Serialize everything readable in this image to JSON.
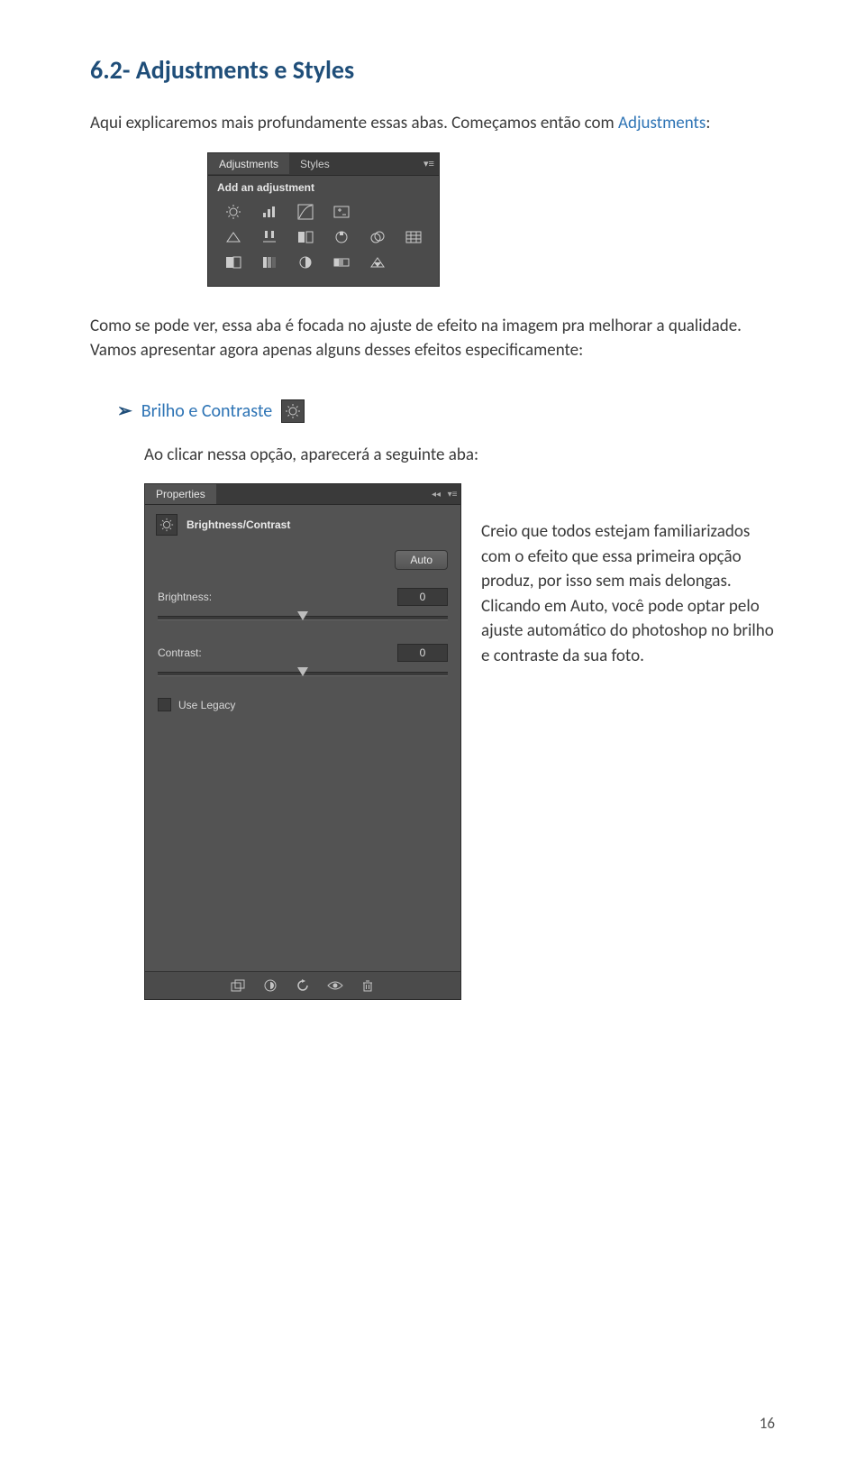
{
  "heading": "6.2- Adjustments e Styles",
  "intro_1": "Aqui explicaremos mais profundamente essas abas. Começamos então com ",
  "intro_link": "Adjustments",
  "intro_2": ":",
  "adjustments_panel": {
    "tab_adjustments": "Adjustments",
    "tab_styles": "Styles",
    "subheading": "Add an adjustment"
  },
  "mid_para": "Como se pode ver, essa aba é focada no ajuste de efeito na imagem pra melhorar a qualidade. Vamos apresentar agora apenas alguns desses efeitos especificamente:",
  "bullet_label": "Brilho e Contraste",
  "indent_para": "Ao clicar nessa opção, aparecerá a seguinte aba:",
  "properties_panel": {
    "tab_label": "Properties",
    "title": "Brightness/Contrast",
    "auto_label": "Auto",
    "brightness_label": "Brightness:",
    "brightness_value": "0",
    "contrast_label": "Contrast:",
    "contrast_value": "0",
    "legacy_label": "Use Legacy"
  },
  "side_text": "Creio que todos estejam familiarizados com o efeito que essa primeira opção produz, por isso sem mais delongas. Clicando em Auto, você pode optar pelo ajuste automático do photoshop no brilho e contraste da sua foto.",
  "page_number": "16"
}
